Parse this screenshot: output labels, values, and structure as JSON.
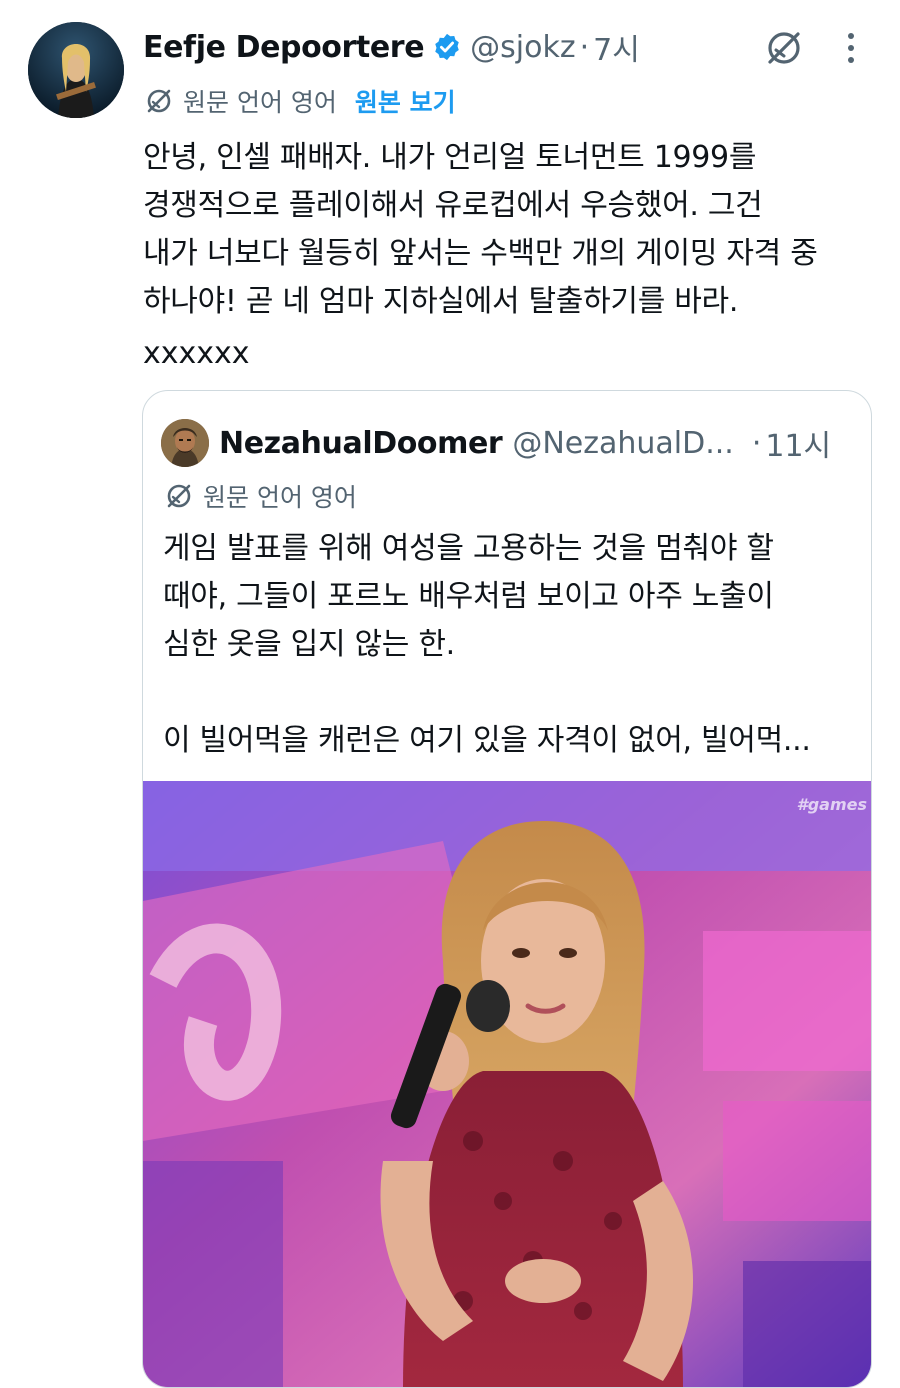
{
  "author": {
    "name": "Eefje Depoortere",
    "handle": "@sjokz",
    "separator": "·",
    "time": "7시"
  },
  "translation": {
    "label": "원문 언어 영어",
    "show_original": "원본 보기"
  },
  "tweet": {
    "lines": [
      "안녕, 인셀 패배자. 내가 언리얼 토너먼트 1999를",
      "경쟁적으로 플레이해서 유로컵에서 우승했어. 그건",
      "내가 너보다 월등히 앞서는 수백만 개의 게이밍 자격 중",
      "하나야! 곧 네 엄마 지하실에서 탈출하기를 바라."
    ],
    "signoff": "xxxxxx"
  },
  "quoted": {
    "name": "NezahualDoomer",
    "handle": "@NezahualD...",
    "separator": "·",
    "time": "11시",
    "translation_label": "원문 언어 영어",
    "lines": [
      "게임 발표를 위해 여성을 고용하는 것을 멈춰야 할",
      "때야, 그들이 포르노 배우처럼 보이고 아주 노출이",
      "심한 옷을 입지 않는 한."
    ],
    "line_last": "이 빌어먹을 캐런은 여기 있을 자격이 없어, 빌어먹...",
    "media_watermark": "#games"
  },
  "icons": {
    "verified": "verified-badge-icon",
    "grok": "grok-icon",
    "more": "more-options-icon",
    "translate": "translate-icon"
  },
  "colors": {
    "text": "#0f1419",
    "secondary": "#536471",
    "link": "#1d9bf0",
    "border": "#cfd9de"
  }
}
